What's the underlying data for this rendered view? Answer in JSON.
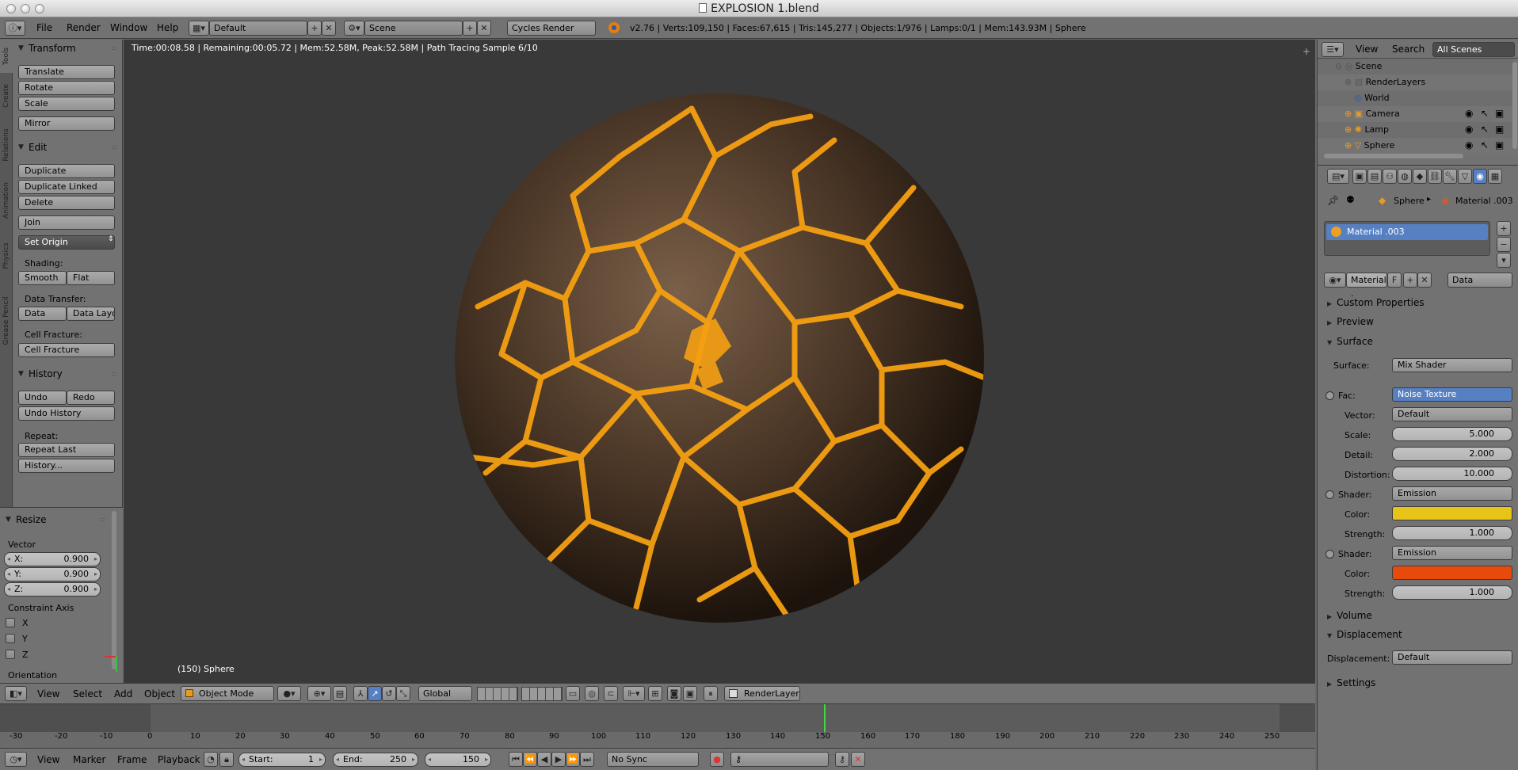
{
  "window": {
    "title": "EXPLOSION 1.blend"
  },
  "info_header": {
    "menus": [
      "File",
      "Render",
      "Window",
      "Help"
    ],
    "screen_layout": "Default",
    "scene": "Scene",
    "render_engine": "Cycles Render",
    "stats": "v2.76 | Verts:109,150 | Faces:67,615 | Tris:145,277 | Objects:1/976 | Lamps:0/1 | Mem:143.93M | Sphere"
  },
  "tool_tabs": [
    "Tools",
    "Create",
    "Relations",
    "Animation",
    "Physics",
    "Grease Pencil"
  ],
  "tools": {
    "transform_title": "Transform",
    "translate": "Translate",
    "rotate": "Rotate",
    "scale": "Scale",
    "mirror": "Mirror",
    "edit_title": "Edit",
    "duplicate": "Duplicate",
    "duplicate_linked": "Duplicate Linked",
    "delete": "Delete",
    "join": "Join",
    "set_origin": "Set Origin",
    "shading_label": "Shading:",
    "smooth": "Smooth",
    "flat": "Flat",
    "data_transfer_label": "Data Transfer:",
    "data": "Data",
    "data_layout": "Data Layo",
    "cell_fracture_label": "Cell Fracture:",
    "cell_fracture": "Cell Fracture",
    "history_title": "History",
    "undo": "Undo",
    "redo": "Redo",
    "undo_history": "Undo History",
    "repeat_label": "Repeat:",
    "repeat_last": "Repeat Last",
    "history_dots": "History..."
  },
  "operator": {
    "title": "Resize",
    "vector_label": "Vector",
    "x_label": "X:",
    "x": "0.900",
    "y_label": "Y:",
    "y": "0.900",
    "z_label": "Z:",
    "z": "0.900",
    "constraint_label": "Constraint Axis",
    "axes": [
      "X",
      "Y",
      "Z"
    ],
    "orientation_label": "Orientation"
  },
  "viewport": {
    "render_info": "Time:00:08.58 | Remaining:00:05.72 | Mem:52.58M, Peak:52.58M | Path Tracing Sample 6/10",
    "object_label": "(150) Sphere"
  },
  "view3d_header": {
    "menus": [
      "View",
      "Select",
      "Add",
      "Object"
    ],
    "mode": "Object Mode",
    "orientation": "Global",
    "render_layer": "RenderLayer"
  },
  "timeline": {
    "ticks": [
      "-30",
      "-20",
      "-10",
      "0",
      "10",
      "20",
      "30",
      "40",
      "50",
      "60",
      "70",
      "80",
      "90",
      "100",
      "110",
      "120",
      "130",
      "140",
      "150",
      "160",
      "170",
      "180",
      "190",
      "200",
      "210",
      "220",
      "230",
      "240",
      "250"
    ],
    "menus": [
      "View",
      "Marker",
      "Frame",
      "Playback"
    ],
    "start_label": "Start:",
    "start": "1",
    "end_label": "End:",
    "end": "250",
    "current": "150",
    "sync": "No Sync"
  },
  "outliner": {
    "menus": [
      "View",
      "Search"
    ],
    "filter": "All Scenes",
    "items": [
      "Scene",
      "RenderLayers",
      "World",
      "Camera",
      "Lamp",
      "Sphere"
    ]
  },
  "properties": {
    "breadcrumb_object": "Sphere",
    "breadcrumb_material": "Material .003",
    "slot": "Material .003",
    "material_name": "Material .",
    "fake_user": "F",
    "link": "Data",
    "panels": {
      "custom_properties": "Custom Properties",
      "preview": "Preview",
      "surface": "Surface",
      "volume": "Volume",
      "displacement": "Displacement",
      "settings": "Settings"
    },
    "surface_label": "Surface:",
    "surface": "Mix Shader",
    "fac_label": "Fac:",
    "fac": "Noise Texture",
    "vector_label": "Vector:",
    "vector": "Default",
    "scale_label": "Scale:",
    "scale": "5.000",
    "detail_label": "Detail:",
    "detail": "2.000",
    "distortion_label": "Distortion:",
    "distortion": "10.000",
    "shader1_label": "Shader:",
    "shader1": "Emission",
    "color1_label": "Color:",
    "color1": "#e8c418",
    "strength1_label": "Strength:",
    "strength1": "1.000",
    "shader2_label": "Shader:",
    "shader2": "Emission",
    "color2_label": "Color:",
    "color2": "#e84a0c",
    "strength2_label": "Strength:",
    "strength2": "1.000",
    "displacement_label": "Displacement:",
    "displacement": "Default"
  }
}
